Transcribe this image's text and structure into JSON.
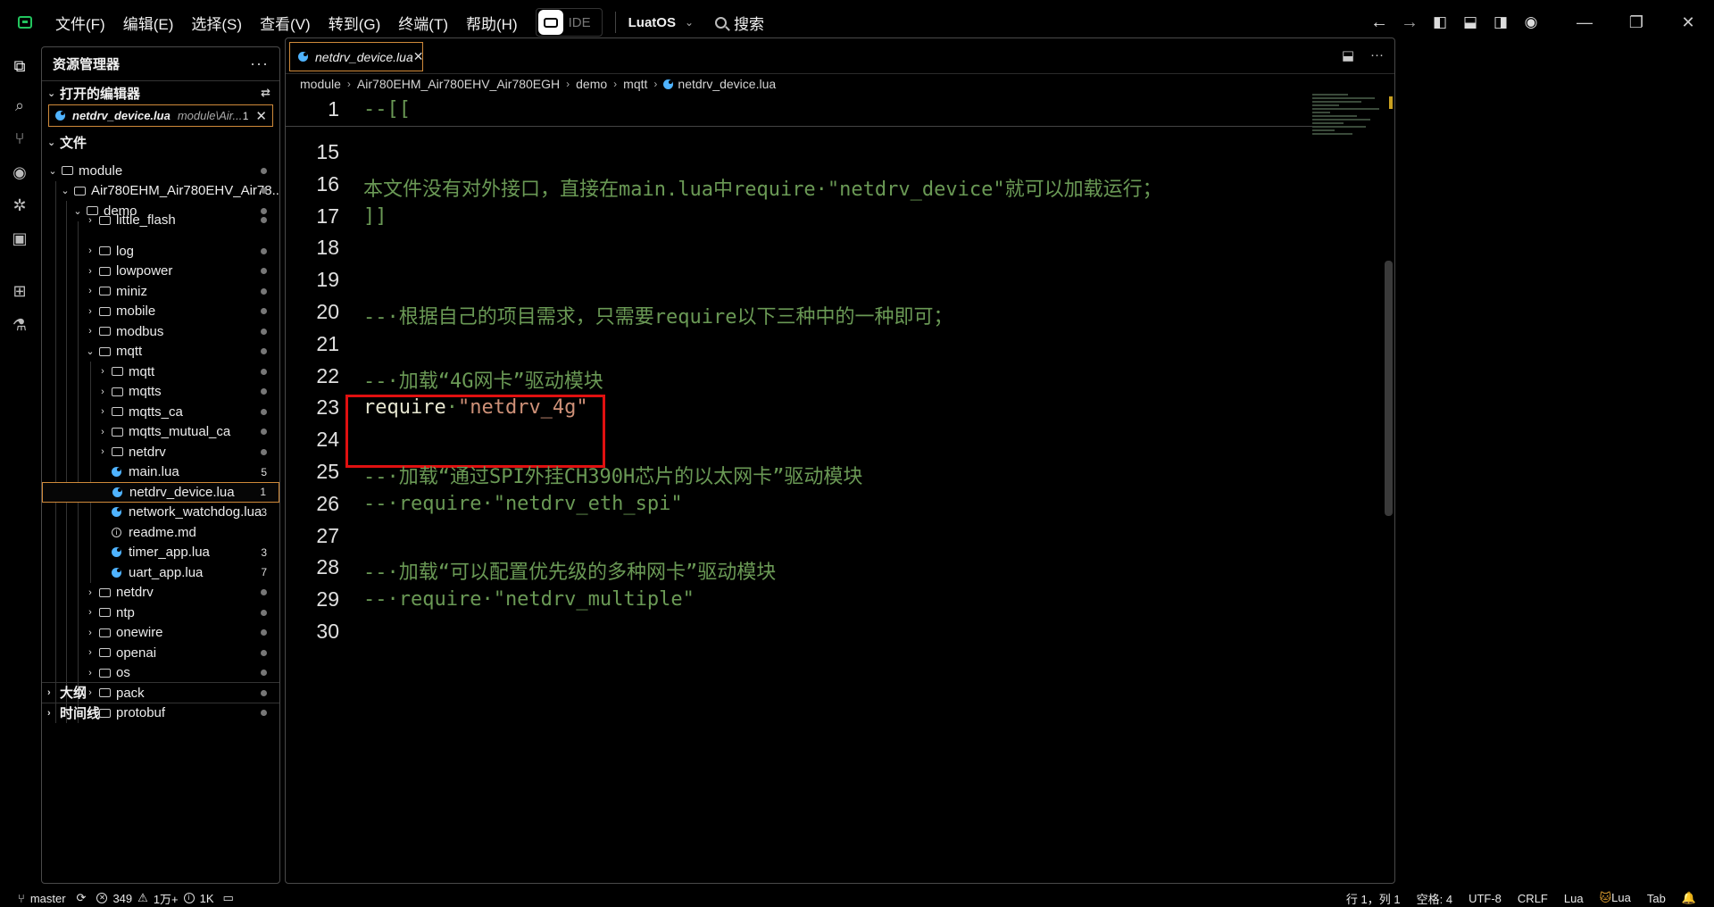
{
  "menu": [
    "文件(F)",
    "编辑(E)",
    "选择(S)",
    "查看(V)",
    "转到(G)",
    "终端(T)",
    "帮助(H)"
  ],
  "ide_label": "IDE",
  "workspace": "LuatOS",
  "search_label": "搜索",
  "sidebar": {
    "title": "资源管理器",
    "open_editors_label": "打开的编辑器",
    "open_editor": {
      "name": "netdrv_device.lua",
      "path": "module\\Air...",
      "count": "1"
    },
    "files_label": "文件",
    "outline_label": "大纲",
    "timeline_label": "时间线",
    "tree": [
      {
        "label": "module",
        "depth": 0,
        "kind": "folder-open",
        "mark": "dot"
      },
      {
        "label": "Air780EHM_Air780EHV_Air78...",
        "depth": 1,
        "kind": "folder-open",
        "mark": "dot"
      },
      {
        "label": "demo",
        "depth": 2,
        "kind": "folder-open",
        "mark": "dot"
      },
      {
        "label": "little_flash",
        "depth": 3,
        "kind": "folder",
        "mark": "dot",
        "cut": true
      },
      {
        "label": "log",
        "depth": 3,
        "kind": "folder",
        "mark": "dot"
      },
      {
        "label": "lowpower",
        "depth": 3,
        "kind": "folder",
        "mark": "dot"
      },
      {
        "label": "miniz",
        "depth": 3,
        "kind": "folder",
        "mark": "dot"
      },
      {
        "label": "mobile",
        "depth": 3,
        "kind": "folder",
        "mark": "dot"
      },
      {
        "label": "modbus",
        "depth": 3,
        "kind": "folder",
        "mark": "dot"
      },
      {
        "label": "mqtt",
        "depth": 3,
        "kind": "folder-open",
        "mark": "dot"
      },
      {
        "label": "mqtt",
        "depth": 4,
        "kind": "folder",
        "mark": "dot"
      },
      {
        "label": "mqtts",
        "depth": 4,
        "kind": "folder",
        "mark": "dot"
      },
      {
        "label": "mqtts_ca",
        "depth": 4,
        "kind": "folder",
        "mark": "dot"
      },
      {
        "label": "mqtts_mutual_ca",
        "depth": 4,
        "kind": "folder",
        "mark": "dot"
      },
      {
        "label": "netdrv",
        "depth": 4,
        "kind": "folder",
        "mark": "dot"
      },
      {
        "label": "main.lua",
        "depth": 4,
        "kind": "lua",
        "mark": "5"
      },
      {
        "label": "netdrv_device.lua",
        "depth": 4,
        "kind": "lua",
        "mark": "1",
        "selected": true
      },
      {
        "label": "network_watchdog.lua",
        "depth": 4,
        "kind": "lua",
        "mark": "3"
      },
      {
        "label": "readme.md",
        "depth": 4,
        "kind": "info",
        "mark": ""
      },
      {
        "label": "timer_app.lua",
        "depth": 4,
        "kind": "lua",
        "mark": "3"
      },
      {
        "label": "uart_app.lua",
        "depth": 4,
        "kind": "lua",
        "mark": "7"
      },
      {
        "label": "netdrv",
        "depth": 3,
        "kind": "folder",
        "mark": "dot"
      },
      {
        "label": "ntp",
        "depth": 3,
        "kind": "folder",
        "mark": "dot"
      },
      {
        "label": "onewire",
        "depth": 3,
        "kind": "folder",
        "mark": "dot"
      },
      {
        "label": "openai",
        "depth": 3,
        "kind": "folder",
        "mark": "dot"
      },
      {
        "label": "os",
        "depth": 3,
        "kind": "folder",
        "mark": "dot"
      },
      {
        "label": "pack",
        "depth": 3,
        "kind": "folder",
        "mark": "dot"
      },
      {
        "label": "protobuf",
        "depth": 3,
        "kind": "folder",
        "mark": "dot",
        "cut": true
      }
    ]
  },
  "editor": {
    "tab_label": "netdrv_device.lua",
    "breadcrumbs": [
      "module",
      "Air780EHM_Air780EHV_Air780EGH",
      "demo",
      "mqtt",
      "netdrv_device.lua"
    ],
    "sticky_line": {
      "num": "1",
      "text": "--[["
    },
    "lines": [
      {
        "num": "15",
        "parts": []
      },
      {
        "num": "16",
        "parts": [
          {
            "t": "本文件没有对外接口，直接在main.lua中require·\"netdrv_device\"就可以加载运行；",
            "c": "c-comment"
          }
        ]
      },
      {
        "num": "17",
        "parts": [
          {
            "t": "]]",
            "c": "c-comment"
          }
        ]
      },
      {
        "num": "18",
        "parts": []
      },
      {
        "num": "19",
        "parts": []
      },
      {
        "num": "20",
        "parts": [
          {
            "t": "--·根据自己的项目需求，只需要require以下三种中的一种即可；",
            "c": "c-comment"
          }
        ]
      },
      {
        "num": "21",
        "parts": []
      },
      {
        "num": "22",
        "parts": [
          {
            "t": "--·加载“4G网卡”驱动模块",
            "c": "c-comment"
          }
        ]
      },
      {
        "num": "23",
        "parts": [
          {
            "t": "require",
            "c": "c-kw"
          },
          {
            "t": "·",
            "c": "c-comment"
          },
          {
            "t": "\"netdrv_4g\"",
            "c": "c-str"
          }
        ]
      },
      {
        "num": "24",
        "parts": []
      },
      {
        "num": "25",
        "parts": [
          {
            "t": "--·加载“通过SPI外挂CH390H芯片的以太网卡”驱动模块",
            "c": "c-comment"
          }
        ]
      },
      {
        "num": "26",
        "parts": [
          {
            "t": "--·require·\"netdrv_eth_spi\"",
            "c": "c-comment"
          }
        ]
      },
      {
        "num": "27",
        "parts": []
      },
      {
        "num": "28",
        "parts": [
          {
            "t": "--·加载“可以配置优先级的多种网卡”驱动模块",
            "c": "c-comment"
          }
        ]
      },
      {
        "num": "29",
        "parts": [
          {
            "t": "--·require·\"netdrv_multiple\"",
            "c": "c-comment"
          }
        ]
      },
      {
        "num": "30",
        "parts": []
      }
    ]
  },
  "statusbar": {
    "branch": "master",
    "errors": "349",
    "warnings": "1万+",
    "infos": "1K",
    "position": "行 1，列 1",
    "spaces": "空格: 4",
    "encoding": "UTF-8",
    "eol": "CRLF",
    "language": "Lua",
    "lang_badge": "Lua",
    "tab": "Tab"
  },
  "colors": {
    "accent_border": "#d08a3a",
    "highlight_box": "#e01010",
    "comment": "#6a9955",
    "string": "#ce9178"
  }
}
